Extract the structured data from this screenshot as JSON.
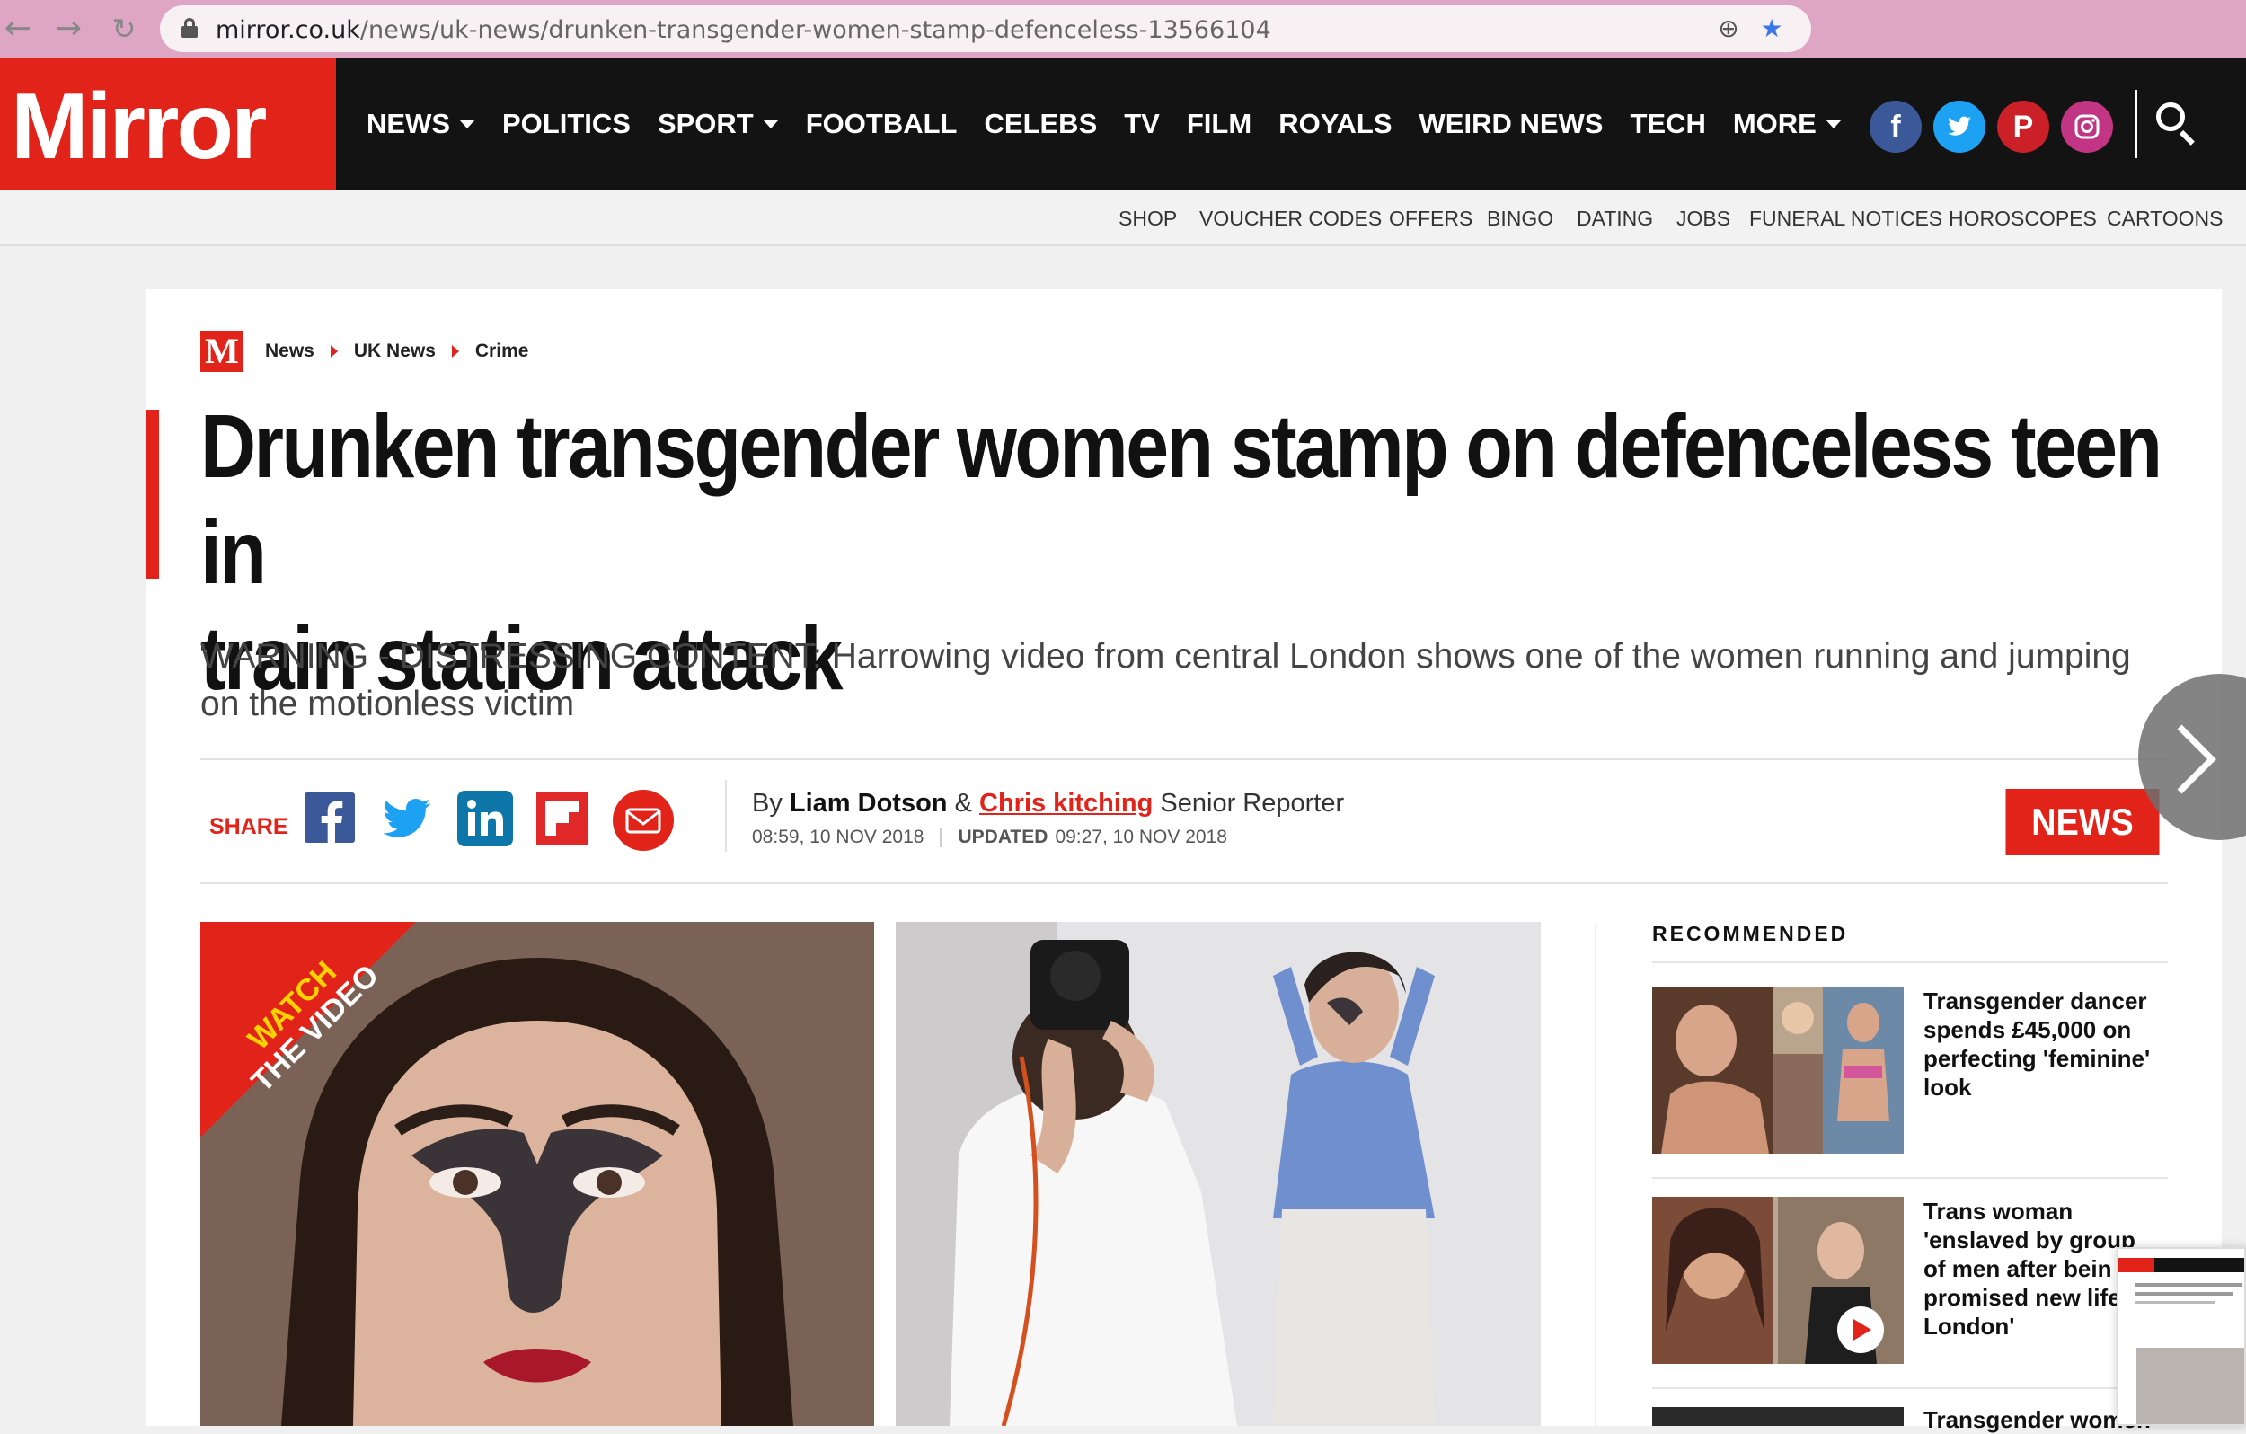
{
  "browser": {
    "url_domain": "mirror.co.uk",
    "url_path": "/news/uk-news/drunken-transgender-women-stamp-defenceless-13566104"
  },
  "header": {
    "logo": "Mirror",
    "nav": [
      "NEWS",
      "POLITICS",
      "SPORT",
      "FOOTBALL",
      "CELEBS",
      "TV",
      "FILM",
      "ROYALS",
      "WEIRD NEWS",
      "TECH",
      "MORE"
    ],
    "social_colors": {
      "facebook": "#3b5998",
      "twitter": "#1da1f2",
      "pinterest": "#cb2027",
      "instagram": "#c13584"
    }
  },
  "subnav": [
    "SHOP",
    "VOUCHER CODES",
    "OFFERS",
    "BINGO",
    "DATING",
    "JOBS",
    "FUNERAL NOTICES",
    "HOROSCOPES",
    "CARTOONS"
  ],
  "breadcrumb": {
    "logo": "M",
    "items": [
      "News",
      "UK News",
      "Crime"
    ]
  },
  "article": {
    "headline_line1": "Drunken transgender women stamp on defenceless teen in",
    "headline_line2": "train station attack",
    "standfirst": "WARNING - DISTRESSING CONTENT: Harrowing video from central London shows one of the women running and jumping on the motionless victim",
    "share_label": "SHARE",
    "byline_prefix": "By",
    "author1": "Liam Dotson",
    "amp": "&",
    "author2": "Chris kitching",
    "author2_role": "Senior Reporter",
    "published": "08:59, 10 NOV 2018",
    "updated_label": "UPDATED",
    "updated": "09:27, 10 NOV 2018",
    "tag": "NEWS",
    "video_badge_line1": "WATCH",
    "video_badge_line2": "THE VIDEO"
  },
  "recommended": {
    "title": "RECOMMENDED",
    "items": [
      {
        "headline": "Transgender dancer spends £45,000 on perfecting 'feminine' look"
      },
      {
        "headline": "Trans woman 'enslaved by group of men after bein promised new life London'"
      },
      {
        "headline": "Transgender women"
      }
    ]
  },
  "colors": {
    "brand_red": "#e2231a",
    "header_black": "#131313",
    "browser_pink": "#dea6c4"
  }
}
